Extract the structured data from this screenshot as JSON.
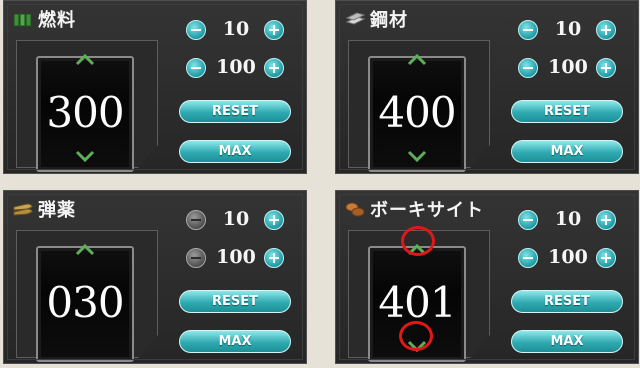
{
  "panels": [
    {
      "name": "燃料",
      "icon": "fuel-icon",
      "value": "300",
      "steps": [
        {
          "value": "10",
          "minus_enabled": true
        },
        {
          "value": "100",
          "minus_enabled": true
        }
      ],
      "reset_label": "RESET",
      "max_label": "MAX",
      "highlighted_arrows": false
    },
    {
      "name": "鋼材",
      "icon": "steel-icon",
      "value": "400",
      "steps": [
        {
          "value": "10",
          "minus_enabled": true
        },
        {
          "value": "100",
          "minus_enabled": true
        }
      ],
      "reset_label": "RESET",
      "max_label": "MAX",
      "highlighted_arrows": false
    },
    {
      "name": "弾薬",
      "icon": "ammo-icon",
      "value": "030",
      "steps": [
        {
          "value": "10",
          "minus_enabled": false
        },
        {
          "value": "100",
          "minus_enabled": false
        }
      ],
      "reset_label": "RESET",
      "max_label": "MAX",
      "highlighted_arrows": false
    },
    {
      "name": "ボーキサイト",
      "icon": "bauxite-icon",
      "value": "401",
      "steps": [
        {
          "value": "10",
          "minus_enabled": true
        },
        {
          "value": "100",
          "minus_enabled": true
        }
      ],
      "reset_label": "RESET",
      "max_label": "MAX",
      "highlighted_arrows": true
    }
  ],
  "colors": {
    "accent": "#2faab1",
    "highlight": "#e01818",
    "arrow": "#5fae5a"
  }
}
